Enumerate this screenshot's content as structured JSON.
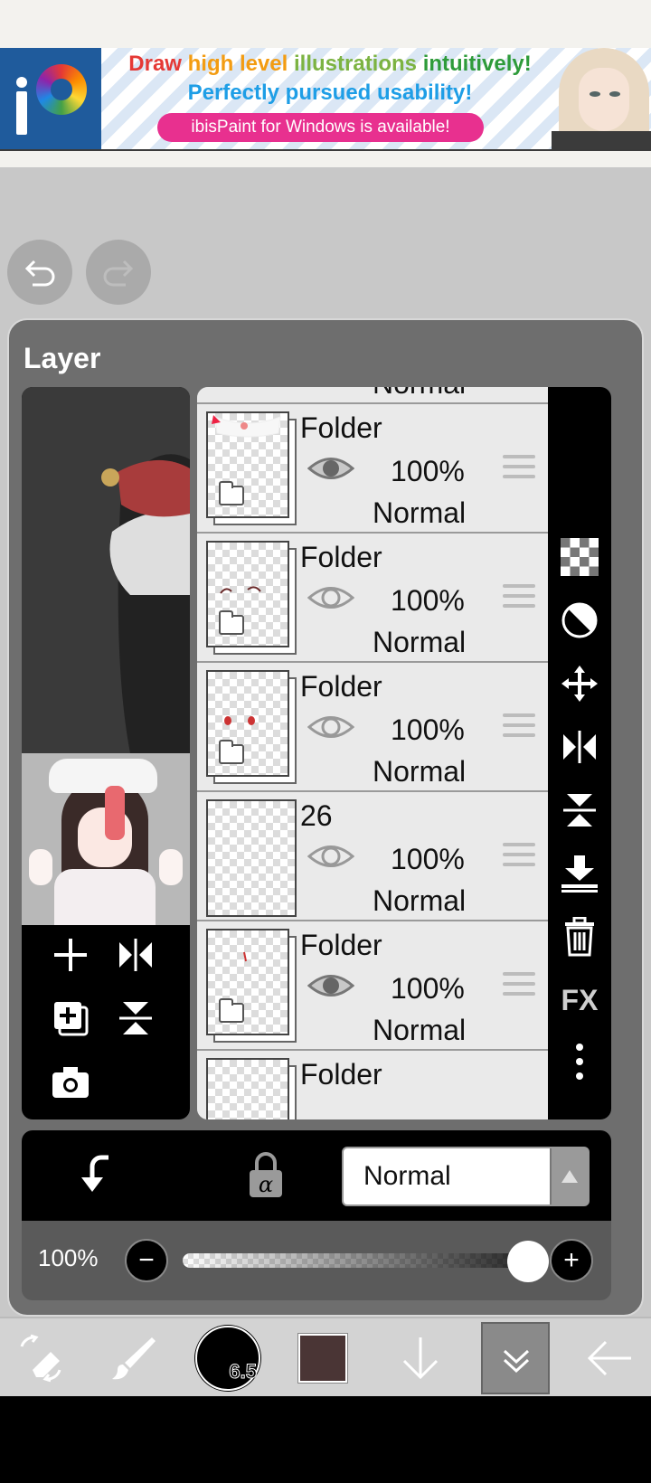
{
  "ad": {
    "line1_parts": [
      "Draw",
      "high level",
      "illustrations",
      "intuitively!"
    ],
    "line2": "Perfectly pursued usability!",
    "line3": "ibisPaint for Windows is available!"
  },
  "panel": {
    "title": "Layer"
  },
  "layers": [
    {
      "name": "Folder",
      "opacity": "100%",
      "blend": "Normal",
      "visible": true,
      "type": "folder"
    },
    {
      "name": "Folder",
      "opacity": "100%",
      "blend": "Normal",
      "visible": false,
      "type": "folder"
    },
    {
      "name": "Folder",
      "opacity": "100%",
      "blend": "Normal",
      "visible": false,
      "type": "folder"
    },
    {
      "name": "26",
      "opacity": "100%",
      "blend": "Normal",
      "visible": false,
      "type": "layer"
    },
    {
      "name": "Folder",
      "opacity": "100%",
      "blend": "Normal",
      "visible": true,
      "type": "folder"
    },
    {
      "name": "Folder",
      "opacity": "",
      "blend": "",
      "visible": false,
      "type": "folder"
    }
  ],
  "partial_top_row": {
    "blend": "Normal"
  },
  "blend_mode": {
    "selected": "Normal"
  },
  "opacity_control": {
    "label": "100%",
    "value": 1.0,
    "minus": "−",
    "plus": "+"
  },
  "sidebar": {
    "fx_label": "FX"
  },
  "toolbar": {
    "brush_size": "6.5",
    "color": "#4a3535"
  },
  "colors": {
    "panel_bg": "#6e6e6e",
    "list_bg": "#eaeaea",
    "accent_pink": "#e8308f"
  }
}
